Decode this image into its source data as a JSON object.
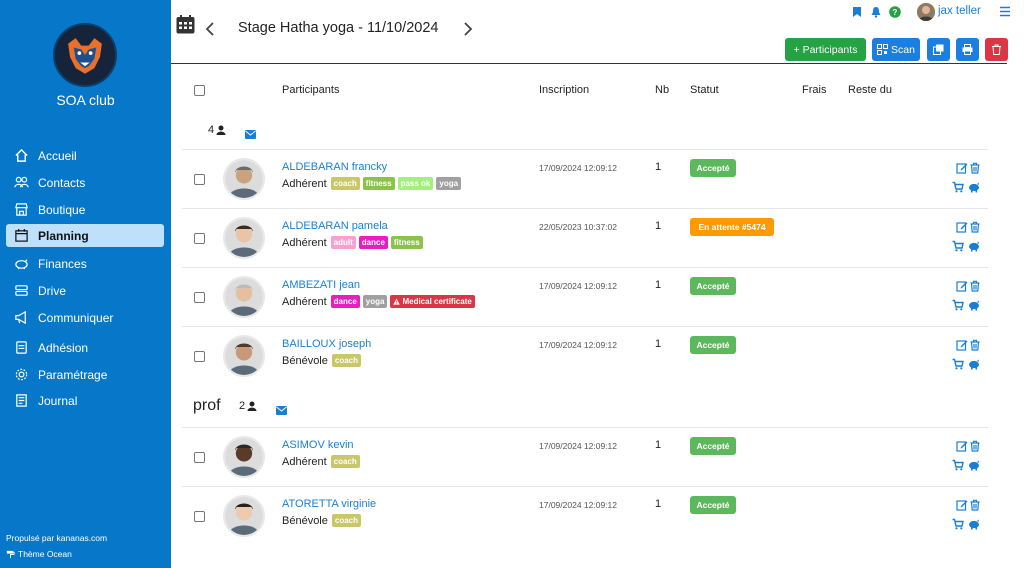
{
  "sidebar": {
    "club_name": "SOA club",
    "items": [
      {
        "label": "Accueil",
        "icon": "home-icon"
      },
      {
        "label": "Contacts",
        "icon": "users-icon"
      },
      {
        "label": "Boutique",
        "icon": "store-icon"
      },
      {
        "label": "Planning",
        "icon": "calendar-icon",
        "active": true
      },
      {
        "label": "Finances",
        "icon": "piggy-bank-icon"
      },
      {
        "label": "Drive",
        "icon": "drive-icon"
      },
      {
        "label": "Communiquer",
        "icon": "megaphone-icon"
      },
      {
        "label": "Adhésion",
        "icon": "card-icon"
      },
      {
        "label": "Paramétrage",
        "icon": "gear-icon"
      },
      {
        "label": "Journal",
        "icon": "journal-icon"
      }
    ],
    "footer_powered": "Propulsé par kananas.com",
    "footer_theme": "Thème Ocean"
  },
  "header": {
    "title": "Stage Hatha yoga - 11/10/2024",
    "user_name": "jax teller",
    "buttons": {
      "participants": "+ Participants",
      "scan": "Scan"
    }
  },
  "table": {
    "columns": {
      "participants": "Participants",
      "inscription": "Inscription",
      "nb": "Nb",
      "statut": "Statut",
      "frais": "Frais",
      "reste": "Reste du"
    },
    "groups": [
      {
        "name": "",
        "count": "4",
        "rows": [
          {
            "name": "ALDEBARAN francky",
            "role": "Adhérent",
            "tags": [
              "coach",
              "fitness",
              "pass ok",
              "yoga"
            ],
            "date": "17/09/2024 12:09:12",
            "nb": "1",
            "status": "Accepté"
          },
          {
            "name": "ALDEBARAN pamela",
            "role": "Adhérent",
            "tags": [
              "adult",
              "dance",
              "fitness"
            ],
            "date": "22/05/2023 10:37:02",
            "nb": "1",
            "status": "En attente #5474"
          },
          {
            "name": "AMBEZATI jean",
            "role": "Adhérent",
            "tags": [
              "dance",
              "yoga",
              "Medical certificate"
            ],
            "date": "17/09/2024 12:09:12",
            "nb": "1",
            "status": "Accepté"
          },
          {
            "name": "BAILLOUX joseph",
            "role": "Bénévole",
            "tags": [
              "coach"
            ],
            "date": "17/09/2024 12:09:12",
            "nb": "1",
            "status": "Accepté"
          }
        ]
      },
      {
        "name": "prof",
        "count": "2",
        "rows": [
          {
            "name": "ASIMOV kevin",
            "role": "Adhérent",
            "tags": [
              "coach"
            ],
            "date": "17/09/2024 12:09:12",
            "nb": "1",
            "status": "Accepté"
          },
          {
            "name": "ATORETTA virginie",
            "role": "Bénévole",
            "tags": [
              "coach"
            ],
            "date": "17/09/2024 12:09:12",
            "nb": "1",
            "status": "Accepté"
          }
        ]
      }
    ]
  },
  "colors": {
    "sidebar": "#0778c9",
    "accepted": "#5cb85c",
    "pending": "#fd9a00",
    "coach": "#c8c86a",
    "fitness": "#8bc34a",
    "pass_ok": "#a3f07e",
    "yoga": "#a0a0a0",
    "adult": "#f7a1d2",
    "dance": "#e91ec0",
    "medical": "#dc3545",
    "link": "#1a7fd4"
  }
}
